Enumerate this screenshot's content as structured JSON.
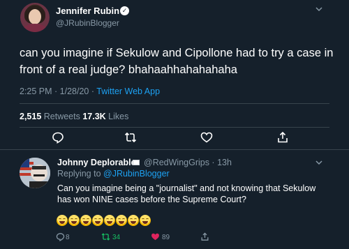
{
  "tweet": {
    "author_name": "Jennifer Rubin",
    "verified_glyph": "✓",
    "author_handle": "@JRubinBlogger",
    "text": "can you imagine if Sekulow and Cipollone had to try a case in front of a real judge? bhahaahhahahahaha",
    "time": "2:25 PM · 1/28/20 · ",
    "source": "Twitter Web App",
    "retweets_count": "2,515",
    "retweets_label": " Retweets  ",
    "likes_count": "17.3K",
    "likes_label": " Likes",
    "icons": [
      "reply-icon",
      "retweet-icon",
      "like-icon",
      "share-icon",
      "chevron-down-icon"
    ]
  },
  "reply": {
    "author_name": "Johnny Deplorable",
    "handle_time": "@RedWingGrips · 13h",
    "replying_label": "Replying to ",
    "replying_handle": "@JRubinBlogger",
    "text": "Can you imagine being a \"journalist\" and not knowing that Sekulow has won NINE cases before the Supreme Court?",
    "emoji_count": 8,
    "reply_count": "8",
    "retweet_count": "34",
    "like_count": "89"
  },
  "colors": {
    "background": "#15202b",
    "secondary_text": "#8899a6",
    "link": "#1da1f2",
    "divider": "#38444d",
    "retweet_green": "#17bf63",
    "like_pink": "#e0245e"
  }
}
